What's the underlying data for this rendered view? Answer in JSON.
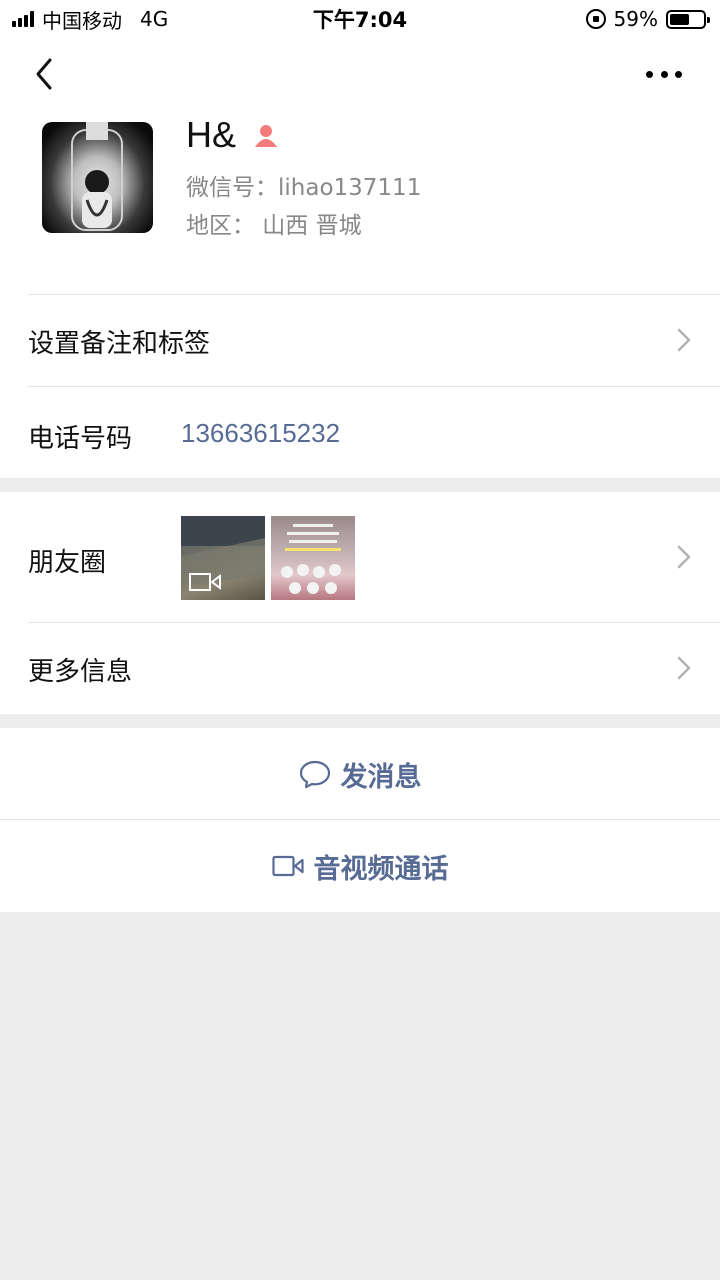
{
  "status_bar": {
    "carrier": "中国移动",
    "network": "4G",
    "time": "下午7:04",
    "battery_text": "59%",
    "battery_level": 0.59
  },
  "profile": {
    "nickname": "H&",
    "wechat_id": "微信号：lihao137111",
    "region": "地区：  山西 晋城",
    "gender_icon": "female-icon",
    "gender_color": "#fa5151"
  },
  "rows": {
    "remark_label": "设置备注和标签",
    "phone_label": "电话号码",
    "phone_value": "13663615232",
    "moments_label": "朋友圈",
    "more_info_label": "更多信息"
  },
  "actions": {
    "message_label": "发消息",
    "call_label": "音视频通话"
  },
  "colors": {
    "link": "#576b95",
    "background": "#ededed",
    "card": "#ffffff"
  }
}
